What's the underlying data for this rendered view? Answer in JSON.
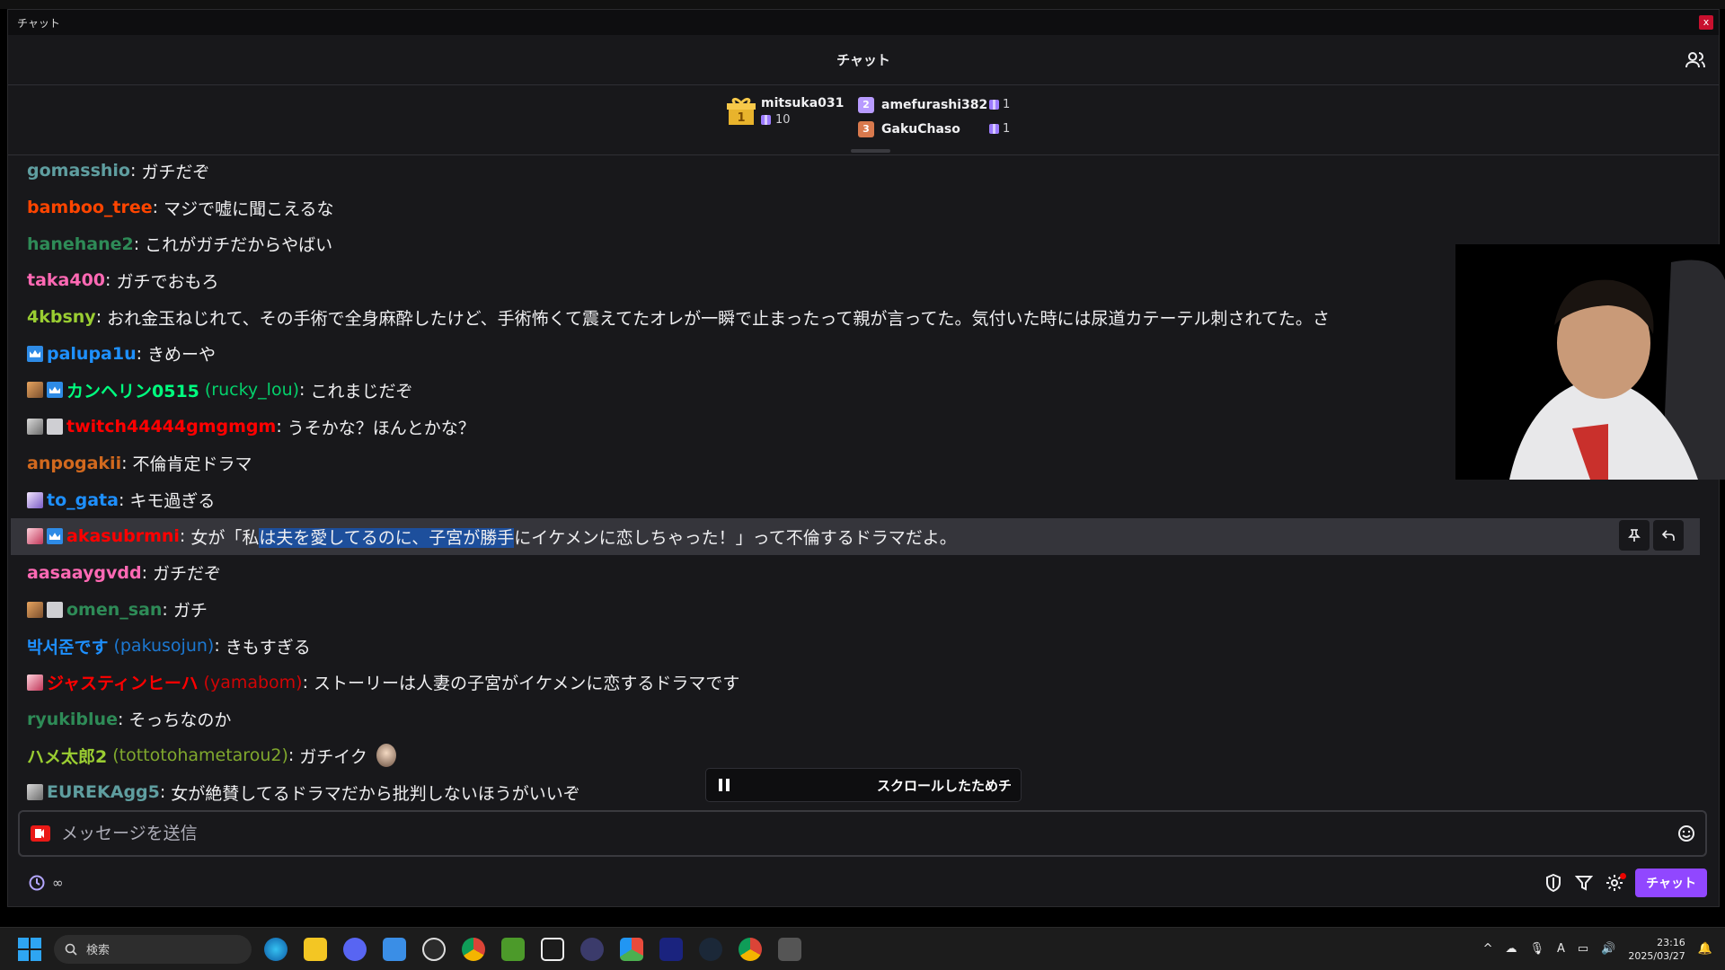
{
  "window": {
    "title": "チャット",
    "close_label": "x"
  },
  "header": {
    "title": "チャット"
  },
  "gift_leaderboard": {
    "first": {
      "rank": "1",
      "user": "mitsuka031",
      "count": "10"
    },
    "others": [
      {
        "rank": "2",
        "user": "amefurashi382",
        "count": "1"
      },
      {
        "rank": "3",
        "user": "GakuChaso",
        "count": "1"
      }
    ]
  },
  "messages": [
    {
      "user": "gomasshio",
      "login": "",
      "color": "#5f9ea0",
      "badges": [],
      "text": "ガチだぞ"
    },
    {
      "user": "bamboo_tree",
      "login": "",
      "color": "#ff4500",
      "badges": [],
      "text": "マジで嘘に聞こえるな"
    },
    {
      "user": "hanehane2",
      "login": "",
      "color": "#2e8b57",
      "badges": [],
      "text": "これがガチだからやばい"
    },
    {
      "user": "taka400",
      "login": "",
      "color": "#ff69b4",
      "badges": [],
      "text": "ガチでおもろ"
    },
    {
      "user": "4kbsny",
      "login": "",
      "color": "#9acd32",
      "badges": [],
      "text": "おれ金玉ねじれて、その手術で全身麻酔したけど、手術怖くて震えてたオレが一瞬で止まったって親が言ってた。気付いた時には尿道カテーテル刺されてた。さ"
    },
    {
      "user": "palupa1u",
      "login": "",
      "color": "#1e90ff",
      "badges": [
        "crown"
      ],
      "text": "きめーや"
    },
    {
      "user": "カンヘリン0515",
      "login": "(rucky_lou)",
      "color": "#00ff7f",
      "badges": [
        "av",
        "crown"
      ],
      "text": "これまじだぞ"
    },
    {
      "user": "twitch44444gmgmgm",
      "login": "",
      "color": "#ff0000",
      "badges": [
        "av2",
        "grey"
      ],
      "text": "うそかな？ほんとかな？"
    },
    {
      "user": "anpogakii",
      "login": "",
      "color": "#d2691e",
      "badges": [],
      "text": "不倫肯定ドラマ"
    },
    {
      "user": "to_gata",
      "login": "",
      "color": "#1e90ff",
      "badges": [
        "av3"
      ],
      "text": "キモ過ぎる"
    },
    {
      "user": "akasubrmni",
      "login": "",
      "color": "#ff0000",
      "badges": [
        "av4",
        "crown"
      ],
      "text_before": "女が「私",
      "text_selected": "は夫を愛してるのに、子宮が勝手",
      "text_after": "にイケメンに恋しちゃった！」って不倫するドラマだよ。"
    },
    {
      "user": "aasaaygvdd",
      "login": "",
      "color": "#ff69b4",
      "badges": [],
      "text": "ガチだぞ"
    },
    {
      "user": "omen_san",
      "login": "",
      "color": "#2e8b57",
      "badges": [
        "av",
        "mute"
      ],
      "text": "ガチ"
    },
    {
      "user": "박서준です",
      "login": "(pakusojun)",
      "color": "#1e90ff",
      "badges": [],
      "text": "きもすぎる"
    },
    {
      "user": "ジャスティンヒーハ",
      "login": "(yamabom)",
      "color": "#ff0000",
      "badges": [
        "av4"
      ],
      "text": "ストーリーは人妻の子宮がイケメンに恋するドラマです"
    },
    {
      "user": "ryukiblue",
      "login": "",
      "color": "#2e8b57",
      "badges": [],
      "text": "そっちなのか"
    },
    {
      "user": "ハメ太郎2",
      "login": "(tottotohametarou2)",
      "color": "#9acd32",
      "badges": [],
      "text": "ガチイク",
      "emote": true
    },
    {
      "user": "EUREKAgg5",
      "login": "",
      "color": "#5f9ea0",
      "badges": [
        "av2"
      ],
      "text": "女が絶賛してるドラマだから批判しないほうがいいぞ"
    }
  ],
  "paused_notice": "スクロールしたためチ",
  "input": {
    "placeholder": "メッセージを送信"
  },
  "footer": {
    "timer_label": "∞",
    "chat_button": "チャット"
  },
  "taskbar": {
    "search_placeholder": "検索",
    "time": "23:16",
    "date": "2025/03/27"
  }
}
